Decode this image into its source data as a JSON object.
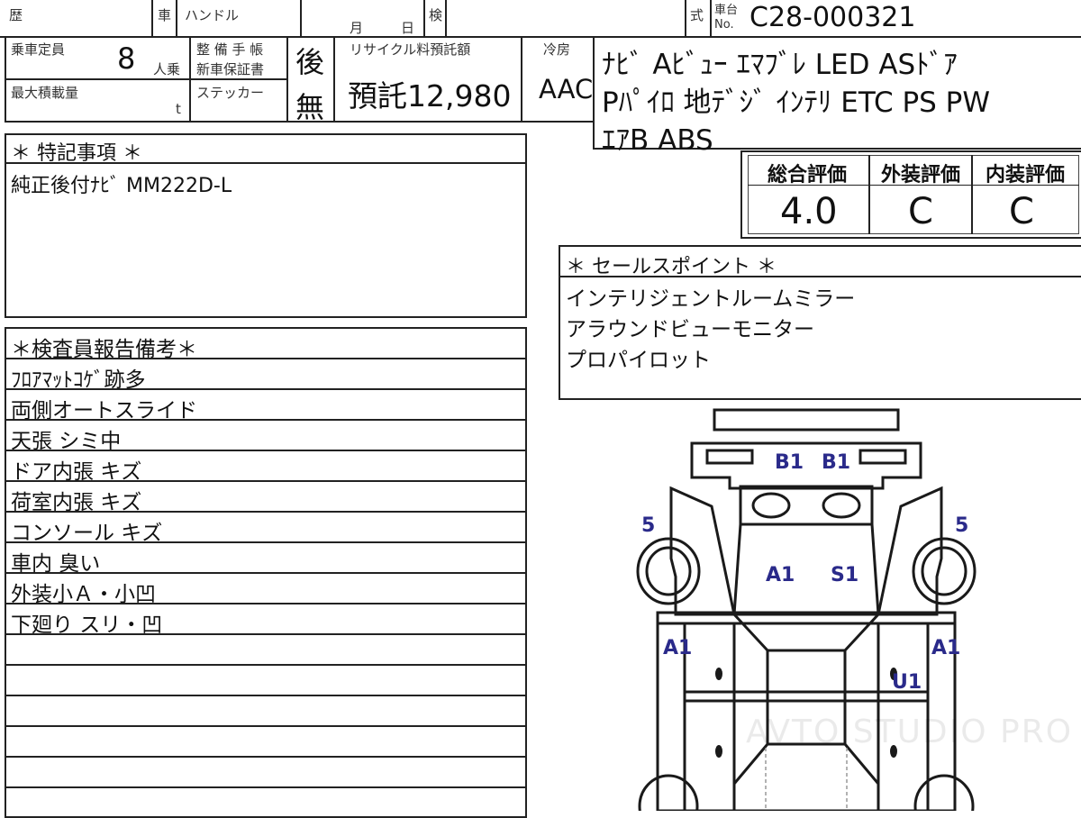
{
  "header": {
    "history_label": "歴",
    "car_label": "車",
    "handle_label": "ハンドル",
    "month_label": "月",
    "day_label": "日",
    "inspection_label": "検",
    "type_label": "式",
    "chassis_label_top": "車台",
    "chassis_label_bottom": "No.",
    "chassis_number": "C28-000321"
  },
  "specs": {
    "capacity_label": "乗車定員",
    "capacity_value": "8",
    "capacity_unit": "人乗",
    "max_load_label": "最大積載量",
    "max_load_unit": "t",
    "maintenance_label_1": "整 備 手 帳",
    "maintenance_label_2": "新車保証書",
    "maintenance_value": "後",
    "sticker_label": "ステッカー",
    "sticker_value": "無",
    "recycle_label": "リサイクル料預託額",
    "recycle_value": "預託12,980",
    "ac_label": "冷房",
    "ac_value": "AAC"
  },
  "equipment": {
    "line1": "ﾅﾋﾞ Aﾋﾞｭｰ ｴﾏﾌﾞﾚ LED ASﾄﾞｱ",
    "line2": "Pﾊﾟｲﾛ 地ﾃﾞｼﾞ ｲﾝﾃﾘ ETC PS PW",
    "line3": "ｴｱB ABS"
  },
  "special_notes": {
    "title": "＊ 特記事項 ＊",
    "text": "純正後付ﾅﾋﾞ MM222D-L"
  },
  "ratings": {
    "overall_label": "総合評価",
    "overall_value": "4.0",
    "exterior_label": "外装評価",
    "exterior_value": "C",
    "interior_label": "内装評価",
    "interior_value": "C"
  },
  "sales_points": {
    "title": "＊ セールスポイント ＊",
    "items": [
      "インテリジェントルームミラー",
      "アラウンドビューモニター",
      "プロパイロット"
    ]
  },
  "inspector_report": {
    "title": "＊検査員報告備考＊",
    "items": [
      "ﾌﾛｱﾏｯﾄｺｹﾞ跡多",
      "両側オートスライド",
      "天張 シミ中",
      "ドア内張 キズ",
      "荷室内張 キズ",
      "コンソール キズ",
      "車内 臭い",
      "外装小Ａ・小凹",
      "下廻り スリ・凹"
    ]
  },
  "diagram_marks": {
    "front_left": "B1",
    "front_right": "B1",
    "left_fender": "5",
    "right_fender": "5",
    "hood_left": "A1",
    "hood_right": "S1",
    "left_door": "A1",
    "right_door": "A1",
    "right_door_lower": "U1"
  },
  "watermark": "AVTO STUDIO PRO"
}
